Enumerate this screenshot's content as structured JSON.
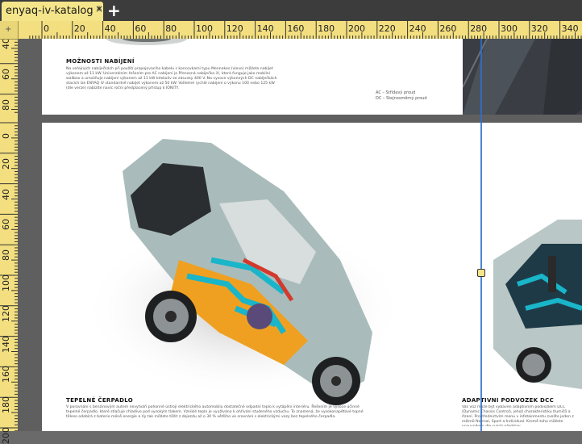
{
  "tab": {
    "title": "enyaq-iv-katalog",
    "modified": "*",
    "close": "×",
    "new": "+"
  },
  "ruler": {
    "top": [
      "0",
      "20",
      "40",
      "60",
      "80",
      "100",
      "120",
      "140",
      "160",
      "180",
      "200",
      "220",
      "240",
      "260",
      "280",
      "300",
      "320",
      "340"
    ],
    "left": [
      "40",
      "60",
      "80",
      "0",
      "20",
      "40",
      "60",
      "80",
      "100",
      "120",
      "140",
      "160",
      "180",
      "200"
    ]
  },
  "page1": {
    "heading": "MOŽNOSTI NABÍJENÍ",
    "body": "Na veřejných nabíječkách při použití propojovacího kabelu s koncovkami typu Mennekes (vlevo) můžete nabíjet výkonem až 11 kW. Univerzálním řešením pro AC nabíjení je Přenosná nabíječka iV, která funguje jako mobilní wallbox a umožňuje nabíjení výkonem až 11 kW kdekoliv ze zásuvky 400 V. Na vysoce výkonných DC nabíječkách stacích lze ENYAQ iV standardně nabíjet výkonem až 50 kW. Volitelné rychlé nabíjení o výkonu 100 nebo 125 kW (dle verze) nabízíte navíc roční předplacený přístup k IONITY.",
    "ac": "AC – Střídavý proud",
    "dc": "DC – Stejnosměrný proud"
  },
  "page2": {
    "heading1": "TEPELNÉ ČERPADLO",
    "body1": "V porovnání s benzinovým autem nevytváří pohonné ústrojí elektrického automobilu dostatečné odpadní teplo k vytápění interiéru. Řešením je vysoce účinné tepelné čerpadlo, které stlačuje chladivo pod vysokým tlakem. Vzniklé teplo je využíváno k ohřívání studeného vzduchu. To znamená, že vysokonapěťové topné těleso odebírá z baterie méně energie a Vy tak můžete těžit z dojezdu až o 30 % většího ve srovnání s elektrickými vozy bez tepelného čerpadla.",
    "heading2": "ADAPTIVNÍ PODVOZEK DCC",
    "body2": "Váš vůz může být vybaven adaptivním podvozkem DCC (Dynamic Chassis Control), jehož charakteristiku tlumičů a řízení. Prostřednictvím menu v infotainmentu zvolíte jeden z režimů Normal, Sport a Individual. Kromě toho můžete posuvníkem dle svých představ"
  },
  "colors": {
    "tab": "#f4e58a",
    "ruler": "#f3df80",
    "guide": "#2f6fd0",
    "car": "#a9bcbb",
    "battery": "#f0a020",
    "cyan": "#19b5c9",
    "red": "#d33a2e"
  }
}
